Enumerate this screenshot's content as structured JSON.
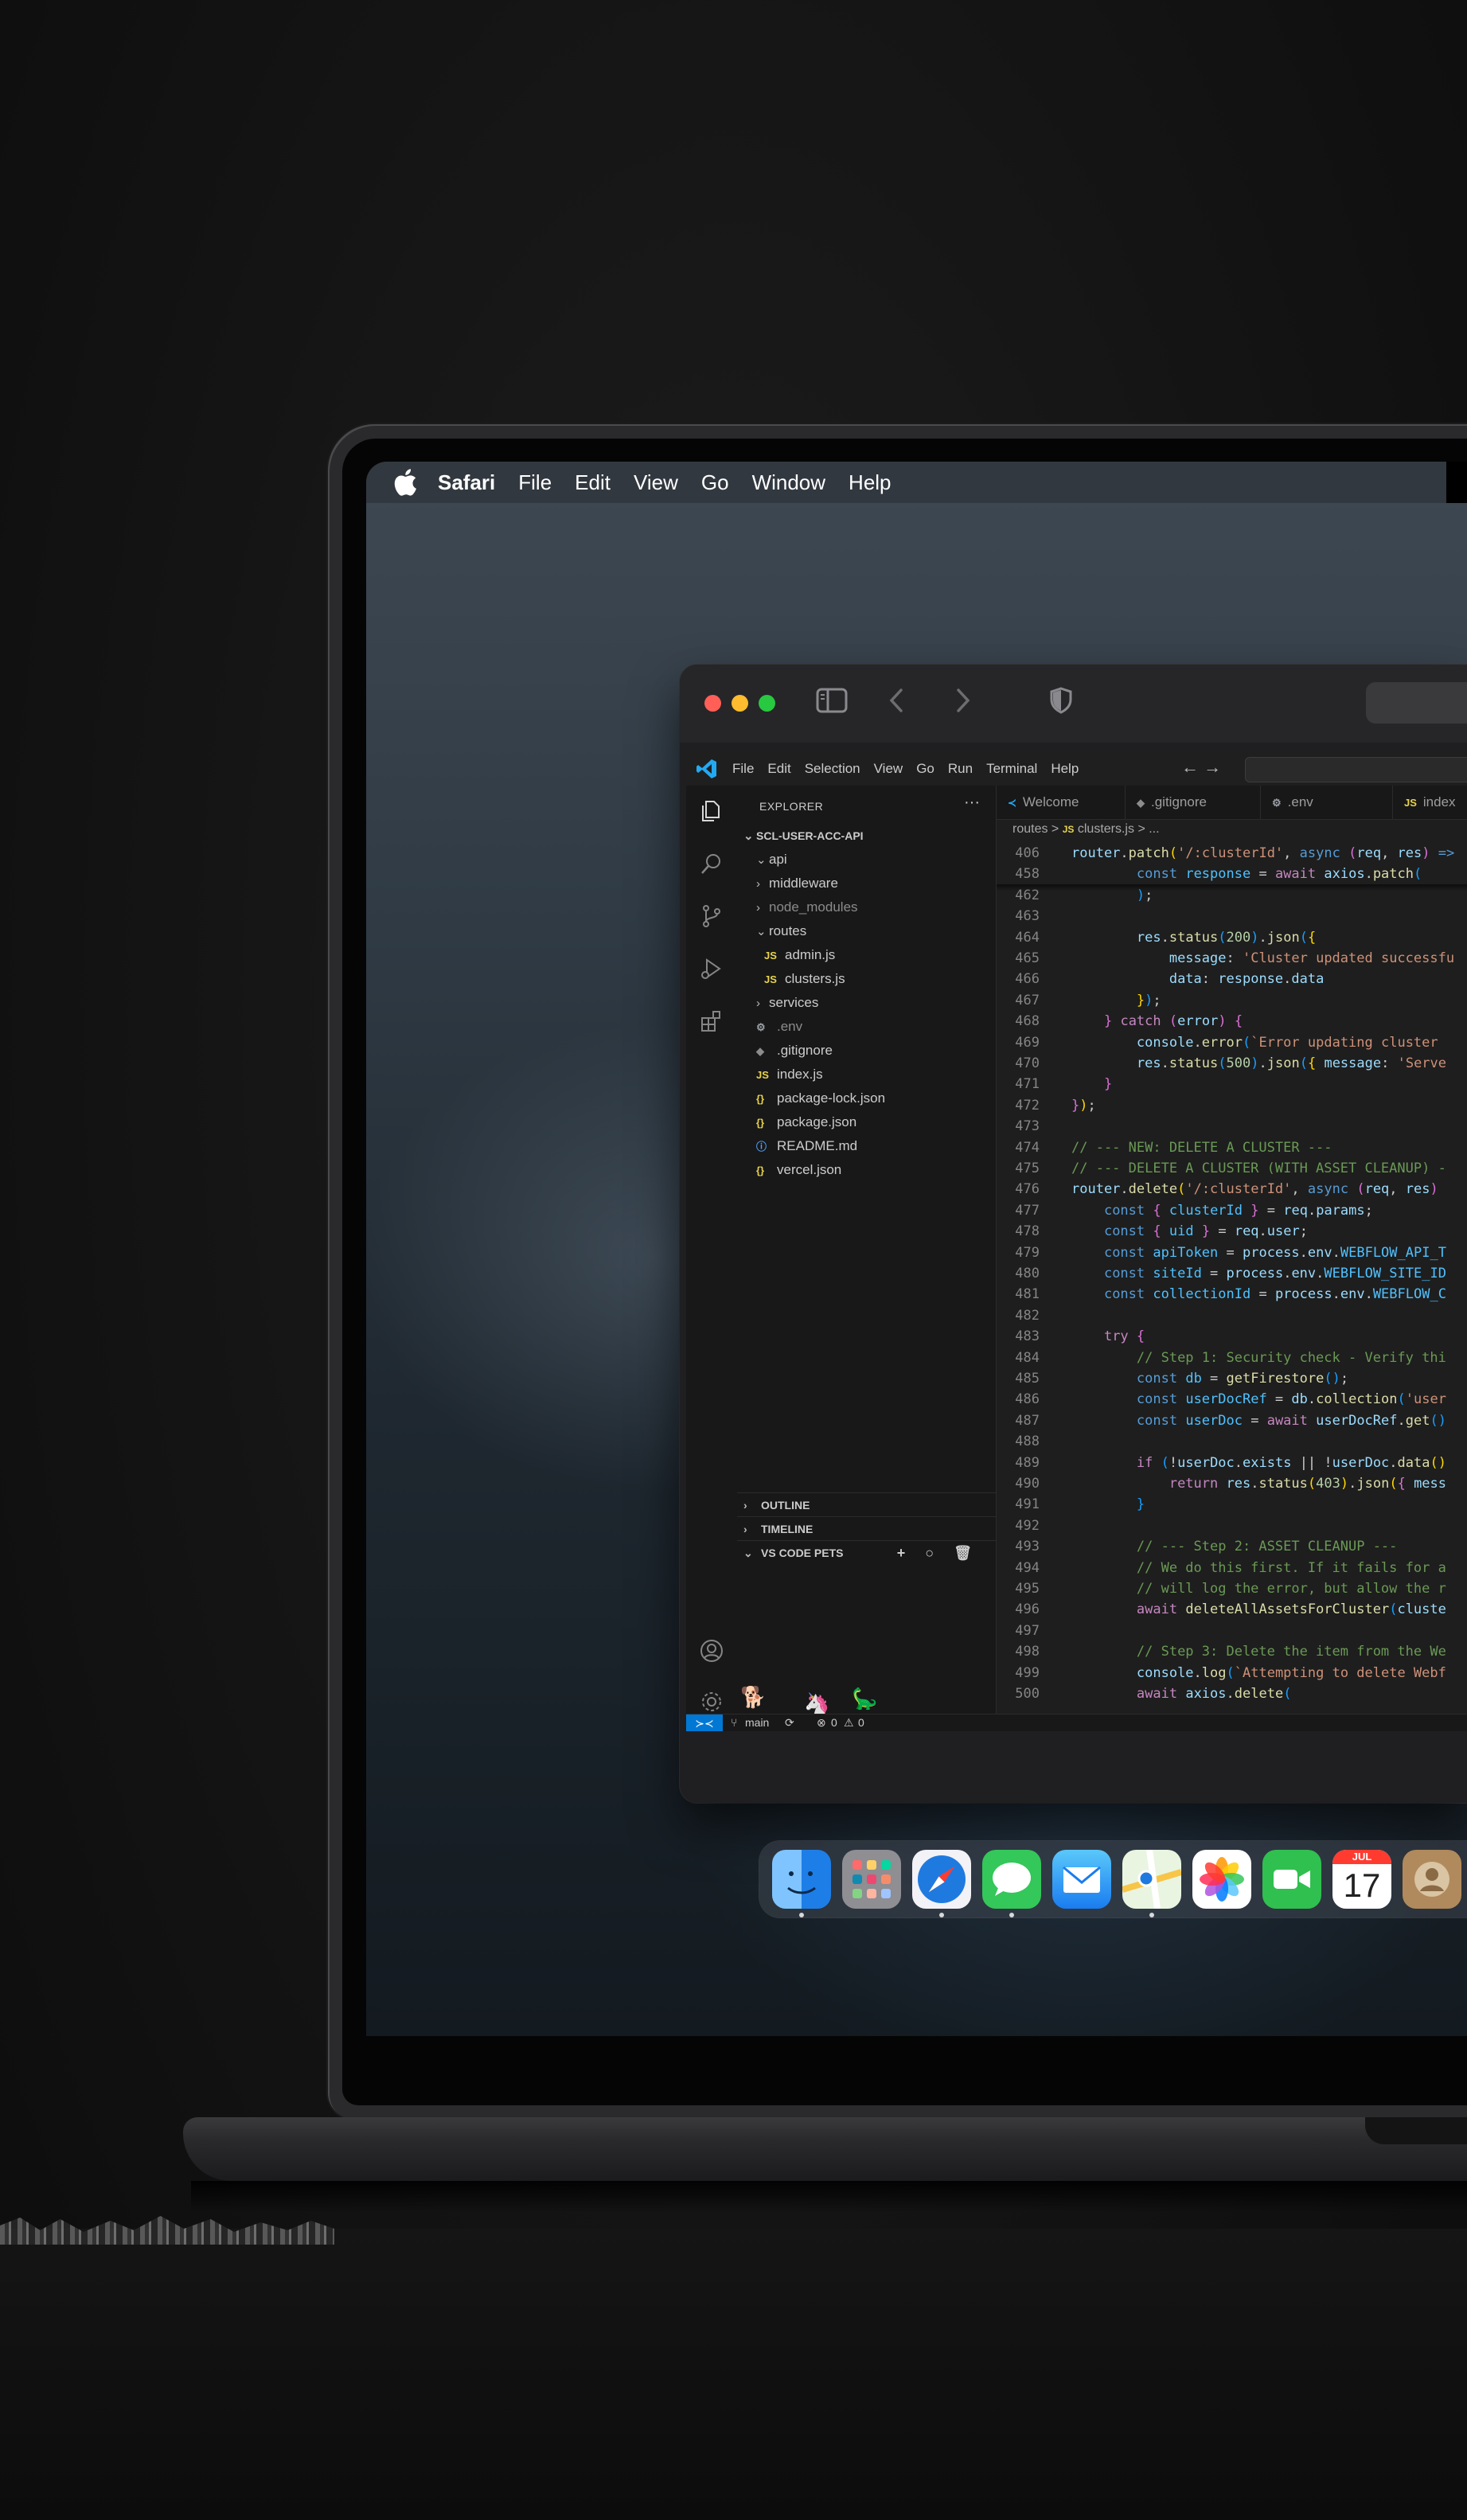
{
  "menubar": {
    "app_name": "Safari",
    "items": [
      "File",
      "Edit",
      "View",
      "Go",
      "Window",
      "Help"
    ]
  },
  "vscode": {
    "menu": [
      "File",
      "Edit",
      "Selection",
      "View",
      "Go",
      "Run",
      "Terminal",
      "Help"
    ],
    "nav": "← →",
    "explorer_title": "EXPLORER",
    "explorer_more": "···",
    "tree": [
      {
        "label": "SCL-USER-ACC-API",
        "kind": "root",
        "chev": "⌄"
      },
      {
        "label": "api",
        "kind": "folder",
        "chev": "⌄"
      },
      {
        "label": "middleware",
        "kind": "folder",
        "chev": "›"
      },
      {
        "label": "node_modules",
        "kind": "folder-dim",
        "chev": "›"
      },
      {
        "label": "routes",
        "kind": "folder",
        "chev": "⌄"
      },
      {
        "label": "admin.js",
        "kind": "js",
        "icon": "JS"
      },
      {
        "label": "clusters.js",
        "kind": "js",
        "icon": "JS"
      },
      {
        "label": "services",
        "kind": "folder",
        "chev": "›"
      },
      {
        "label": ".env",
        "kind": "dim",
        "icon": "⚙"
      },
      {
        "label": ".gitignore",
        "kind": "file",
        "icon": "◆"
      },
      {
        "label": "index.js",
        "kind": "js",
        "icon": "JS"
      },
      {
        "label": "package-lock.json",
        "kind": "json",
        "icon": "{}"
      },
      {
        "label": "package.json",
        "kind": "json",
        "icon": "{}"
      },
      {
        "label": "README.md",
        "kind": "info",
        "icon": "ⓘ"
      },
      {
        "label": "vercel.json",
        "kind": "json",
        "icon": "{}"
      }
    ],
    "panels": [
      "OUTLINE",
      "TIMELINE",
      "VS CODE PETS"
    ],
    "pets_actions": "+ ○ 🗑",
    "tabs": [
      {
        "label": "Welcome",
        "icon": "≺"
      },
      {
        "label": ".gitignore",
        "icon": "◆"
      },
      {
        "label": ".env",
        "icon": "⚙"
      },
      {
        "label": "index",
        "icon": "JS"
      }
    ],
    "breadcrumb": {
      "folder": "routes",
      "sep": ">",
      "icon": "JS",
      "file": "clusters.js",
      "rest": "> ..."
    },
    "status": {
      "branch": "main",
      "sync": "⟳",
      "errors": "0",
      "warnings": "0"
    }
  },
  "code_lines": [
    {
      "n": "406",
      "html": "<span class=\"v\">router</span>.<span class=\"f\">patch</span><span class=\"p\">(</span><span class=\"s\">'/:clusterId'</span>, <span class=\"kw\">async</span> <span class=\"p2\">(</span><span class=\"v\">req</span>, <span class=\"v\">res</span><span class=\"p2\">)</span> <span class=\"kw\">=&gt;</span>"
    },
    {
      "n": "458",
      "html": "        <span class=\"kw\">const</span> <span class=\"cn\">response</span> = <span class=\"k\">await</span> <span class=\"v\">axios</span>.<span class=\"f\">patch</span><span class=\"p3\">(</span>"
    },
    {
      "n": "462",
      "html": "        <span class=\"p3\">)</span>;"
    },
    {
      "n": "463",
      "html": ""
    },
    {
      "n": "464",
      "html": "        <span class=\"v\">res</span>.<span class=\"f\">status</span><span class=\"p3\">(</span><span class=\"n\">200</span><span class=\"p3\">)</span>.<span class=\"f\">json</span><span class=\"p3\">(</span><span class=\"p\">{</span>"
    },
    {
      "n": "465",
      "html": "            <span class=\"v\">message</span>: <span class=\"s\">'Cluster updated successfu</span>"
    },
    {
      "n": "466",
      "html": "            <span class=\"v\">data</span>: <span class=\"v\">response</span>.<span class=\"v\">data</span>"
    },
    {
      "n": "467",
      "html": "        <span class=\"p\">}</span><span class=\"p3\">)</span>;"
    },
    {
      "n": "468",
      "html": "    <span class=\"p2\">}</span> <span class=\"k\">catch</span> <span class=\"p2\">(</span><span class=\"v\">error</span><span class=\"p2\">)</span> <span class=\"p2\">{</span>"
    },
    {
      "n": "469",
      "html": "        <span class=\"v\">console</span>.<span class=\"f\">error</span><span class=\"p3\">(</span><span class=\"s\">`Error updating cluster</span>"
    },
    {
      "n": "470",
      "html": "        <span class=\"v\">res</span>.<span class=\"f\">status</span><span class=\"p3\">(</span><span class=\"n\">500</span><span class=\"p3\">)</span>.<span class=\"f\">json</span><span class=\"p3\">(</span><span class=\"p\">{</span> <span class=\"v\">message</span>: <span class=\"s\">'Serve</span>"
    },
    {
      "n": "471",
      "html": "    <span class=\"p2\">}</span>"
    },
    {
      "n": "472",
      "html": "<span class=\"p2\">}</span><span class=\"p\">)</span>;"
    },
    {
      "n": "473",
      "html": ""
    },
    {
      "n": "474",
      "html": "<span class=\"c\">// --- NEW: DELETE A CLUSTER ---</span>"
    },
    {
      "n": "475",
      "html": "<span class=\"c\">// --- DELETE A CLUSTER (WITH ASSET CLEANUP) -</span>"
    },
    {
      "n": "476",
      "html": "<span class=\"v\">router</span>.<span class=\"f\">delete</span><span class=\"p\">(</span><span class=\"s\">'/:clusterId'</span>, <span class=\"kw\">async</span> <span class=\"p2\">(</span><span class=\"v\">req</span>, <span class=\"v\">res</span><span class=\"p2\">)</span>"
    },
    {
      "n": "477",
      "html": "    <span class=\"kw\">const</span> <span class=\"p2\">{</span> <span class=\"cn\">clusterId</span> <span class=\"p2\">}</span> = <span class=\"v\">req</span>.<span class=\"v\">params</span>;"
    },
    {
      "n": "478",
      "html": "    <span class=\"kw\">const</span> <span class=\"p2\">{</span> <span class=\"cn\">uid</span> <span class=\"p2\">}</span> = <span class=\"v\">req</span>.<span class=\"v\">user</span>;"
    },
    {
      "n": "479",
      "html": "    <span class=\"kw\">const</span> <span class=\"cn\">apiToken</span> = <span class=\"v\">process</span>.<span class=\"v\">env</span>.<span class=\"cn\">WEBFLOW_API_T</span>"
    },
    {
      "n": "480",
      "html": "    <span class=\"kw\">const</span> <span class=\"cn\">siteId</span> = <span class=\"v\">process</span>.<span class=\"v\">env</span>.<span class=\"cn\">WEBFLOW_SITE_ID</span>"
    },
    {
      "n": "481",
      "html": "    <span class=\"kw\">const</span> <span class=\"cn\">collectionId</span> = <span class=\"v\">process</span>.<span class=\"v\">env</span>.<span class=\"cn\">WEBFLOW_C</span>"
    },
    {
      "n": "482",
      "html": ""
    },
    {
      "n": "483",
      "html": "    <span class=\"k\">try</span> <span class=\"p2\">{</span>"
    },
    {
      "n": "484",
      "html": "        <span class=\"c\">// Step 1: Security check - Verify thi</span>"
    },
    {
      "n": "485",
      "html": "        <span class=\"kw\">const</span> <span class=\"cn\">db</span> = <span class=\"f\">getFirestore</span><span class=\"p3\">()</span>;"
    },
    {
      "n": "486",
      "html": "        <span class=\"kw\">const</span> <span class=\"cn\">userDocRef</span> = <span class=\"v\">db</span>.<span class=\"f\">collection</span><span class=\"p3\">(</span><span class=\"s\">'user</span>"
    },
    {
      "n": "487",
      "html": "        <span class=\"kw\">const</span> <span class=\"cn\">userDoc</span> = <span class=\"k\">await</span> <span class=\"v\">userDocRef</span>.<span class=\"f\">get</span><span class=\"p3\">()</span>"
    },
    {
      "n": "488",
      "html": ""
    },
    {
      "n": "489",
      "html": "        <span class=\"k\">if</span> <span class=\"p3\">(</span>!<span class=\"v\">userDoc</span>.<span class=\"v\">exists</span> || !<span class=\"v\">userDoc</span>.<span class=\"f\">data</span><span class=\"p\">()</span>"
    },
    {
      "n": "490",
      "html": "            <span class=\"k\">return</span> <span class=\"v\">res</span>.<span class=\"f\">status</span><span class=\"p\">(</span><span class=\"n\">403</span><span class=\"p\">)</span>.<span class=\"f\">json</span><span class=\"p\">(</span><span class=\"p2\">{</span> <span class=\"v\">mess</span>"
    },
    {
      "n": "491",
      "html": "        <span class=\"p3\">}</span>"
    },
    {
      "n": "492",
      "html": ""
    },
    {
      "n": "493",
      "html": "        <span class=\"c\">// --- Step 2: ASSET CLEANUP ---</span>"
    },
    {
      "n": "494",
      "html": "        <span class=\"c\">// We do this first. If it fails for a</span>"
    },
    {
      "n": "495",
      "html": "        <span class=\"c\">// will log the error, but allow the r</span>"
    },
    {
      "n": "496",
      "html": "        <span class=\"k\">await</span> <span class=\"f\">deleteAllAssetsForCluster</span><span class=\"p3\">(</span><span class=\"v\">cluste</span>"
    },
    {
      "n": "497",
      "html": ""
    },
    {
      "n": "498",
      "html": "        <span class=\"c\">// Step 3: Delete the item from the We</span>"
    },
    {
      "n": "499",
      "html": "        <span class=\"v\">console</span>.<span class=\"f\">log</span><span class=\"p3\">(</span><span class=\"s\">`Attempting to delete Webf</span>"
    },
    {
      "n": "500",
      "html": "        <span class=\"k\">await</span> <span class=\"v\">axios</span>.<span class=\"f\">delete</span><span class=\"p3\">(</span>"
    }
  ],
  "dock": {
    "apps": [
      {
        "name": "finder",
        "color": "#1e90ff",
        "running": true
      },
      {
        "name": "launchpad",
        "color": "#9a9a9a",
        "running": false
      },
      {
        "name": "safari",
        "color": "#1f7ae0",
        "running": true
      },
      {
        "name": "messages",
        "color": "#34c759",
        "running": true
      },
      {
        "name": "mail",
        "color": "#2f8bf5",
        "running": false
      },
      {
        "name": "maps",
        "color": "#5cb85c",
        "running": true
      },
      {
        "name": "photos",
        "color": "#f5f5f5",
        "running": false
      },
      {
        "name": "facetime",
        "color": "#30c04f",
        "running": false
      },
      {
        "name": "calendar",
        "color": "#ffffff",
        "running": false
      },
      {
        "name": "contacts",
        "color": "#b08a5c",
        "running": false
      }
    ],
    "calendar_month": "JUL",
    "calendar_day": "17"
  }
}
